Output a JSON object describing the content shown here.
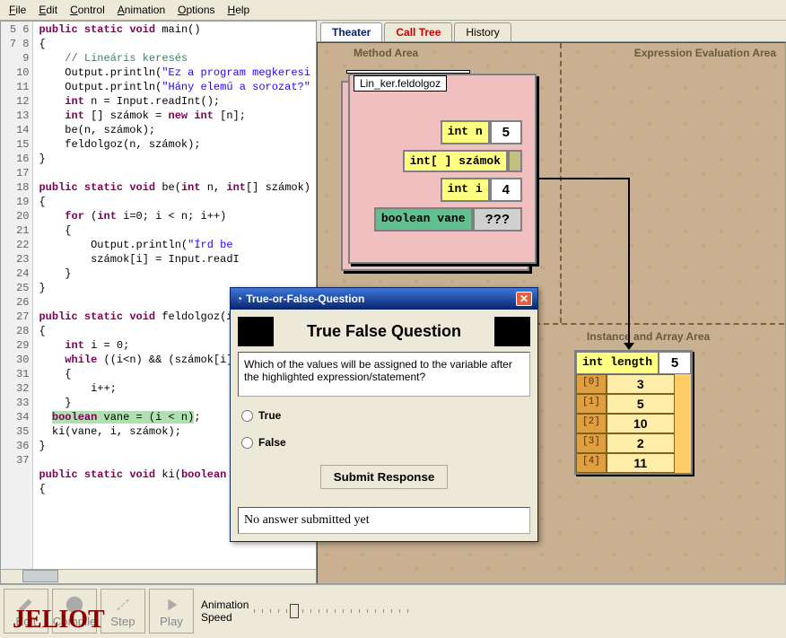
{
  "menu": {
    "file": "File",
    "edit": "Edit",
    "control": "Control",
    "animation": "Animation",
    "options": "Options",
    "help": "Help"
  },
  "tabs": {
    "theater": "Theater",
    "calltree": "Call Tree",
    "history": "History"
  },
  "areas": {
    "method": "Method Area",
    "expr": "Expression Evaluation Area",
    "instance": "Instance and Array Area"
  },
  "frame": {
    "title": "Lin_ker.feldolgoz",
    "vars": {
      "n_label": "int n",
      "n_val": "5",
      "arr_label": "int[ ] számok",
      "i_label": "int i",
      "i_val": "4",
      "vane_label": "boolean vane",
      "vane_val": "???"
    }
  },
  "array": {
    "len_label": "int length",
    "len_val": "5",
    "rows": [
      {
        "idx": "[0]",
        "val": "3"
      },
      {
        "idx": "[1]",
        "val": "5"
      },
      {
        "idx": "[2]",
        "val": "10"
      },
      {
        "idx": "[3]",
        "val": "2"
      },
      {
        "idx": "[4]",
        "val": "11"
      }
    ]
  },
  "code": {
    "lines": [
      5,
      6,
      7,
      8,
      9,
      10,
      11,
      12,
      13,
      14,
      15,
      16,
      17,
      18,
      19,
      20,
      21,
      22,
      23,
      24,
      25,
      26,
      27,
      28,
      29,
      30,
      31,
      32,
      33,
      34,
      35,
      36,
      37
    ]
  },
  "dialog": {
    "title": "True-or-False-Question",
    "heading": "True False Question",
    "question": "Which of the values will be assigned to the variable after the highlighted expression/statement?",
    "opt_true": "True",
    "opt_false": "False",
    "submit": "Submit Response",
    "status": "No answer submitted yet"
  },
  "toolbar": {
    "edit": "Edit",
    "compile": "Compile",
    "step": "Step",
    "play": "Play",
    "speed_lbl": "Animation",
    "speed_lbl2": "Speed",
    "logo": "JELIOT"
  }
}
